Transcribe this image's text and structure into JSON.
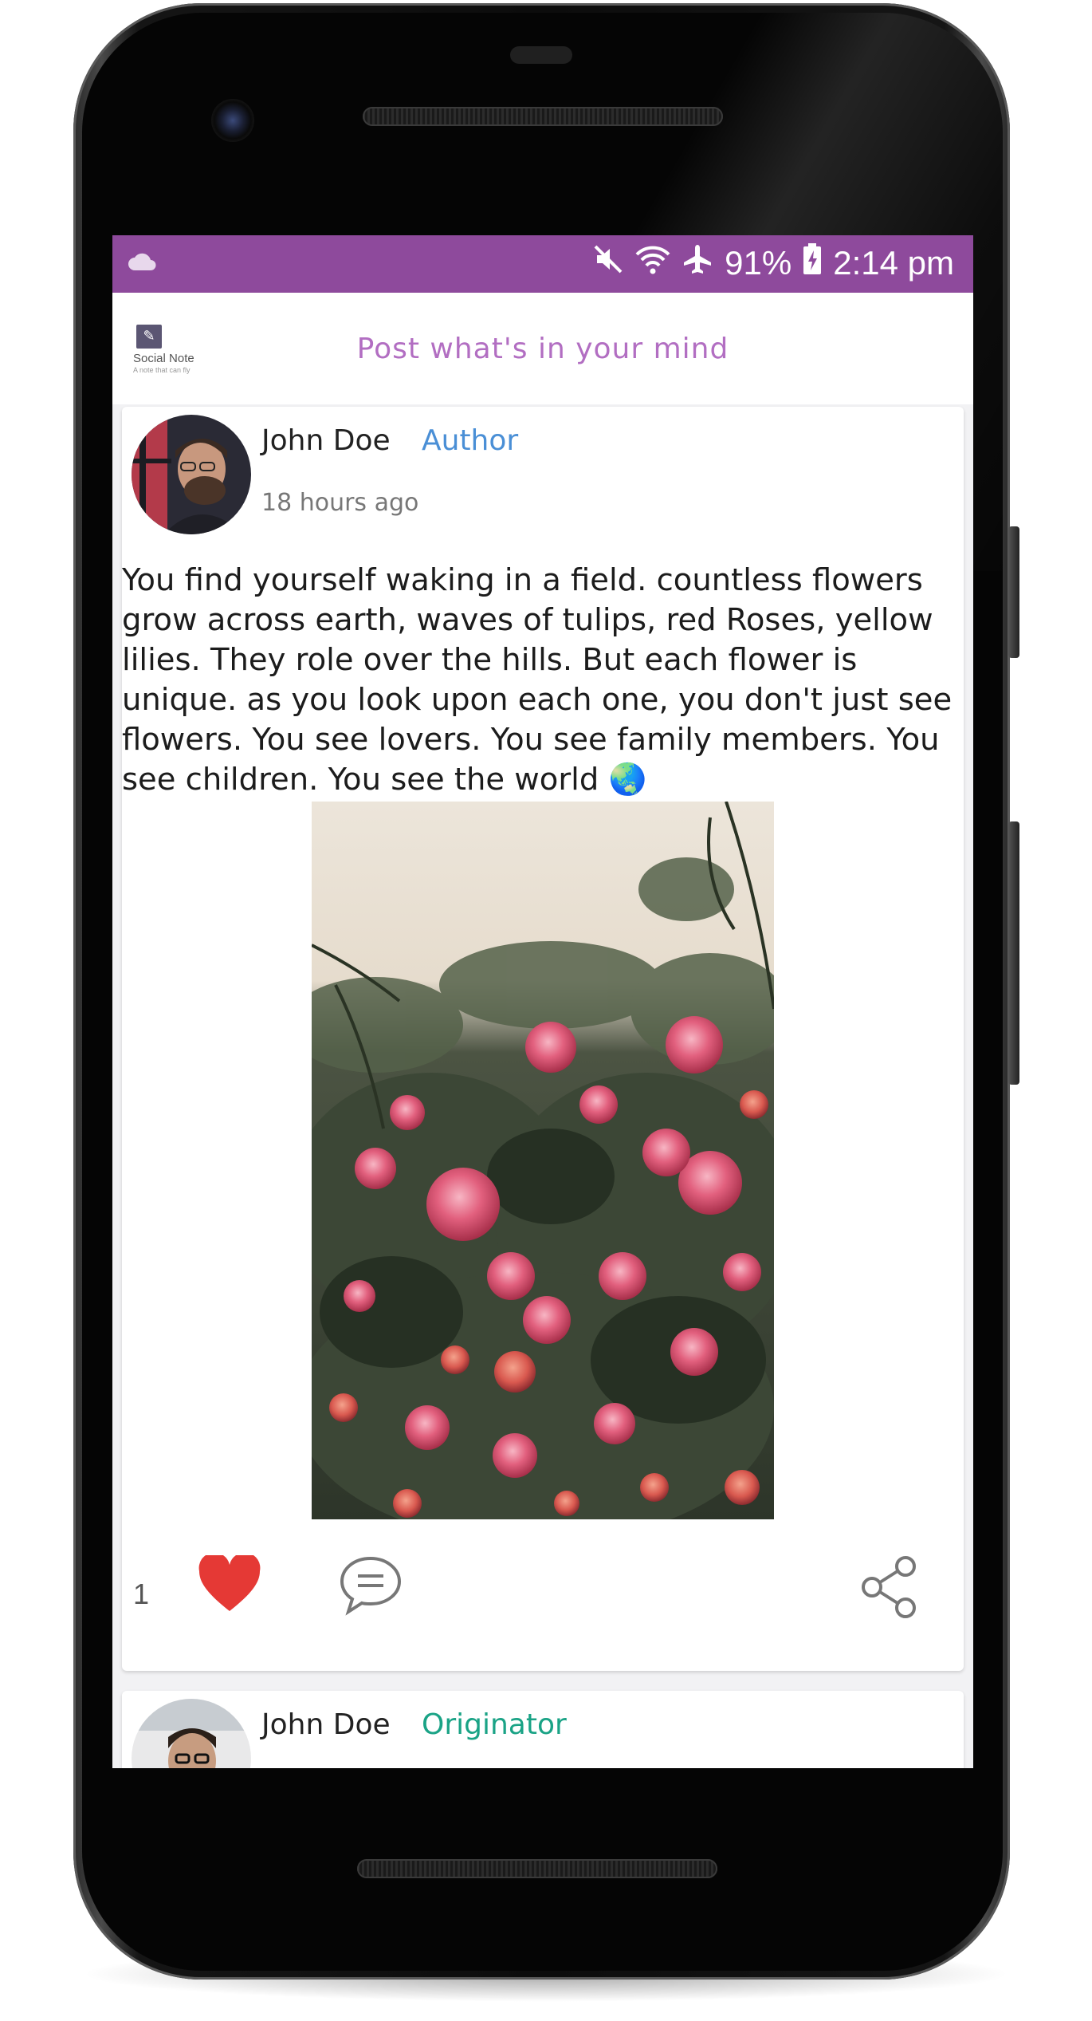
{
  "status_bar": {
    "battery": "91%",
    "time": "2:14 pm",
    "icons": [
      "cloud-icon",
      "mute-icon",
      "wifi-icon",
      "airplane-icon",
      "battery-charging-icon"
    ],
    "color": "#8e4a9c"
  },
  "header": {
    "logo_name": "Social Note",
    "logo_tagline": "A note that can fly",
    "compose_placeholder": "Post what's in your mind",
    "accent": "#b26ec2"
  },
  "posts": [
    {
      "author": "John Doe",
      "role": "Author",
      "role_color": "#4a8fd6",
      "time_ago": "18 hours ago",
      "body": "You find yourself waking in a field. countless flowers grow across earth, waves of tulips, red Roses, yellow lilies. They role over the hills. But each flower is unique. as you look upon each one, you don't just see flowers. You see lovers. You see family members. You see children. You see the world 🌏",
      "image": "rose-bush-photo",
      "like_count": "1",
      "liked": true,
      "like_color": "#e53935"
    },
    {
      "author": "John Doe",
      "role": "Originator",
      "role_color": "#1aa386"
    }
  ]
}
